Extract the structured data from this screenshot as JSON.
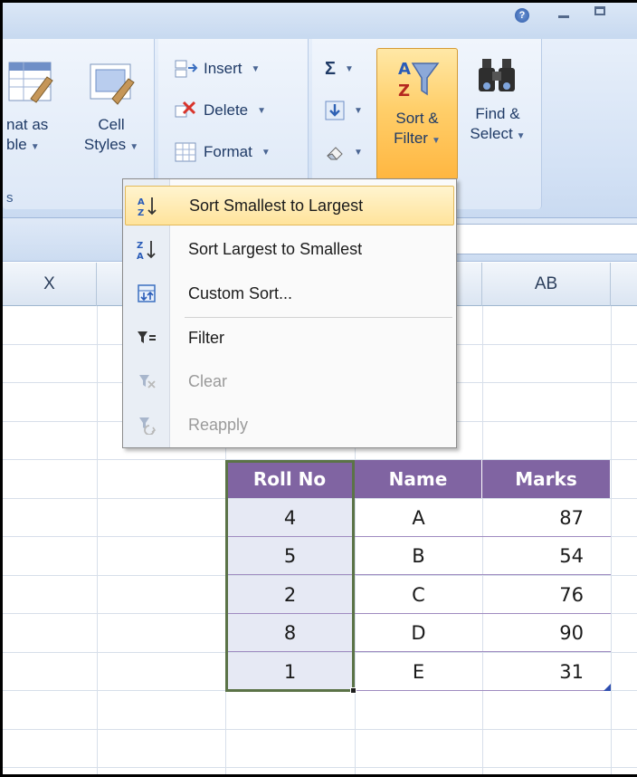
{
  "window": {
    "help_label": "?"
  },
  "ribbon": {
    "styles_group": {
      "format_as_table_line1": "nat as",
      "format_as_table_line2": "ble",
      "cell_styles_line1": "Cell",
      "cell_styles_line2": "Styles",
      "group_label_fragment": "s"
    },
    "cells_group": {
      "insert_label": "Insert",
      "delete_label": "Delete",
      "format_label": "Format"
    },
    "editing_group": {
      "sum_symbol": "Σ",
      "sort_filter_line1": "Sort &",
      "sort_filter_line2": "Filter",
      "find_select_line1": "Find &",
      "find_select_line2": "Select"
    }
  },
  "menu": {
    "items": [
      {
        "label": "Sort Smallest to Largest",
        "icon": "sort-ascending-icon",
        "highlighted": true,
        "disabled": false
      },
      {
        "label": "Sort Largest to Smallest",
        "icon": "sort-descending-icon",
        "highlighted": false,
        "disabled": false
      },
      {
        "label": "Custom Sort...",
        "icon": "custom-sort-icon",
        "highlighted": false,
        "disabled": false
      },
      {
        "label": "Filter",
        "icon": "filter-icon",
        "highlighted": false,
        "disabled": false
      },
      {
        "label": "Clear",
        "icon": "clear-filter-icon",
        "highlighted": false,
        "disabled": true
      },
      {
        "label": "Reapply",
        "icon": "reapply-icon",
        "highlighted": false,
        "disabled": true
      }
    ]
  },
  "sheet": {
    "column_headers": {
      "x": "X",
      "ab": "AB"
    },
    "table": {
      "headers": [
        "Roll No",
        "Name",
        "Marks"
      ],
      "rows": [
        [
          "4",
          "A",
          "87"
        ],
        [
          "5",
          "B",
          "54"
        ],
        [
          "2",
          "C",
          "76"
        ],
        [
          "8",
          "D",
          "90"
        ],
        [
          "1",
          "E",
          "31"
        ]
      ]
    }
  },
  "colors": {
    "table_header": "#8064a2",
    "menu_highlight": "#ffe39b",
    "selection_border": "#5b7347"
  }
}
